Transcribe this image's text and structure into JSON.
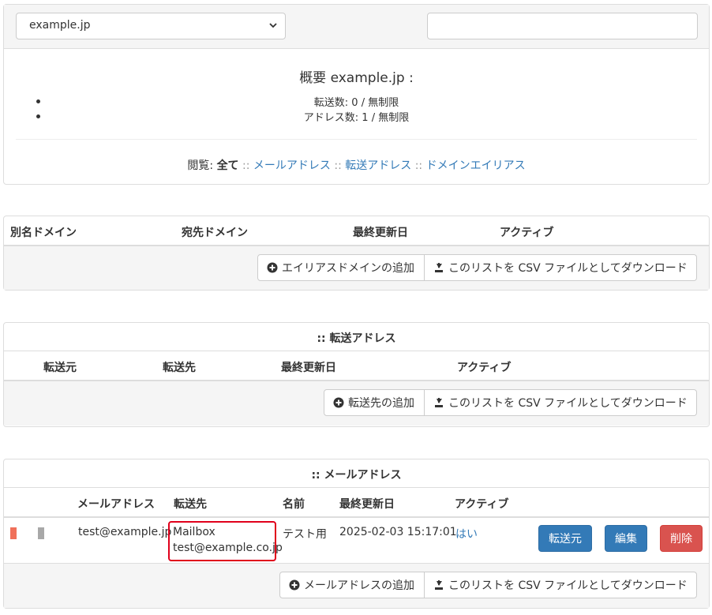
{
  "domain_select": {
    "value": "example.jp"
  },
  "search": {
    "value": ""
  },
  "summary": {
    "title": "概要 example.jp :",
    "items": [
      "転送数: 0 / 無制限",
      "アドレス数: 1 / 無制限"
    ],
    "browse_label": "閲覧:",
    "browse_all": "全て",
    "sep": "::",
    "links": [
      "メールアドレス",
      "転送アドレス",
      "ドメインエイリアス"
    ]
  },
  "alias_domains": {
    "headers": [
      "別名ドメイン",
      "宛先ドメイン",
      "最終更新日",
      "アクティブ"
    ],
    "add_button": "エイリアスドメインの追加",
    "csv_button": "このリストを CSV ファイルとしてダウンロード"
  },
  "forwarding": {
    "caption": ":: 転送アドレス",
    "headers": [
      "転送元",
      "転送先",
      "最終更新日",
      "アクティブ"
    ],
    "add_button": "転送先の追加",
    "csv_button": "このリストを CSV ファイルとしてダウンロード"
  },
  "mailboxes": {
    "caption": ":: メールアドレス",
    "headers": [
      "メールアドレス",
      "転送先",
      "名前",
      "最終更新日",
      "アクティブ"
    ],
    "rows": [
      {
        "address": "test@example.jp",
        "forward_1": "Mailbox",
        "forward_2": "test@example.co.jp",
        "name": "テスト用",
        "modified": "2025-02-03 15:17:01",
        "active": "はい",
        "btn_forward": "転送元",
        "btn_edit": "編集",
        "btn_delete": "削除"
      }
    ],
    "add_button": "メールアドレスの追加",
    "csv_button": "このリストを CSV ファイルとしてダウンロード"
  },
  "colors": {
    "link": "#337ab7",
    "primary": "#337ab7",
    "danger": "#d9534f",
    "highlight": "#e0001b",
    "mark_red": "#f0705a",
    "mark_gray": "#a8a8a8"
  },
  "icons": [
    "chevron-down-icon",
    "plus-circle-icon",
    "download-icon"
  ]
}
